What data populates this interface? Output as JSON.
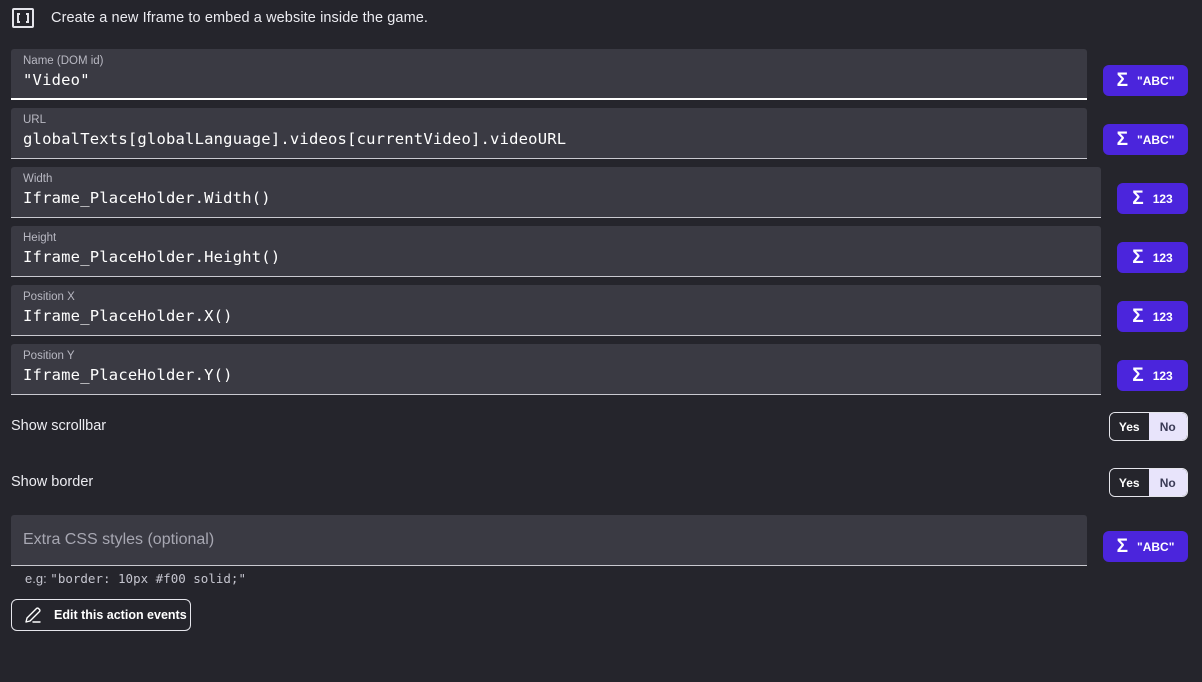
{
  "header": {
    "icon": "iframe-brackets-icon",
    "description": "Create a new Iframe to embed a website inside the game."
  },
  "fields": {
    "name": {
      "label": "Name (DOM id)",
      "value": "\"Video\"",
      "expr_type": "\"ABC\""
    },
    "url": {
      "label": "URL",
      "value": "globalTexts[globalLanguage].videos[currentVideo].videoURL",
      "expr_type": "\"ABC\""
    },
    "width": {
      "label": "Width",
      "value": "Iframe_PlaceHolder.Width()",
      "expr_type": "123"
    },
    "height": {
      "label": "Height",
      "value": "Iframe_PlaceHolder.Height()",
      "expr_type": "123"
    },
    "pos_x": {
      "label": "Position X",
      "value": "Iframe_PlaceHolder.X()",
      "expr_type": "123"
    },
    "pos_y": {
      "label": "Position Y",
      "value": "Iframe_PlaceHolder.Y()",
      "expr_type": "123"
    }
  },
  "toggles": {
    "scrollbar": {
      "label": "Show scrollbar",
      "yes": "Yes",
      "no": "No",
      "selected": "No"
    },
    "border": {
      "label": "Show border",
      "yes": "Yes",
      "no": "No",
      "selected": "No"
    }
  },
  "css": {
    "placeholder": "Extra CSS styles (optional)",
    "expr_type": "\"ABC\"",
    "hint_prefix": "e.g: ",
    "hint_example": "\"border: 10px #f00 solid;\""
  },
  "edit_button": {
    "label": "Edit this action events",
    "icon": "pencil-icon"
  },
  "expr_icon": "sigma-icon",
  "colors": {
    "accent": "#4b25dc",
    "background": "#25252c",
    "field": "#3a3a43",
    "toggle_selected": "#e8e4fb"
  }
}
